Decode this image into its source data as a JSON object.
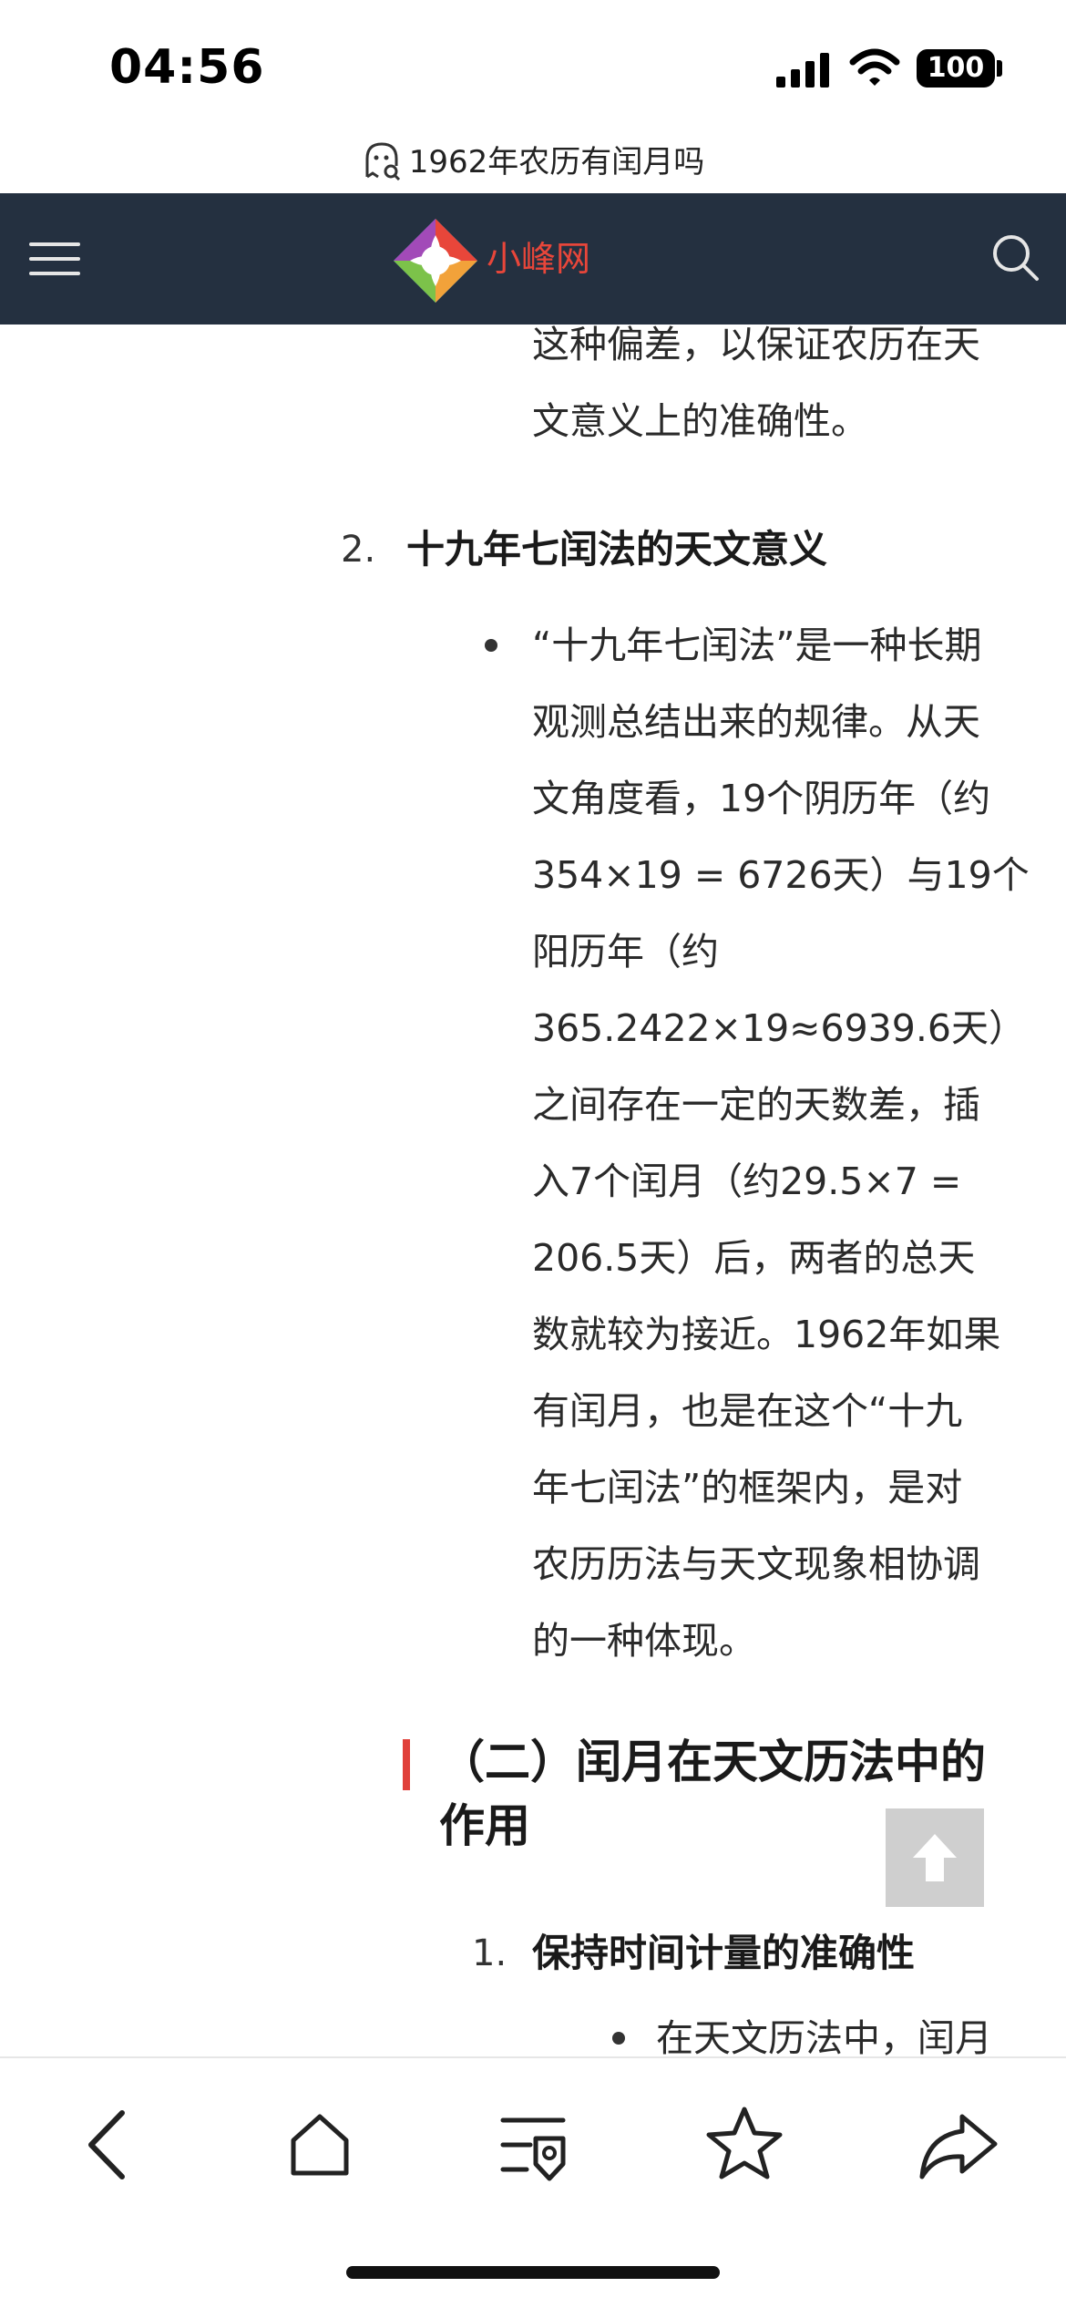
{
  "status_bar": {
    "time": "04:56",
    "battery": "100"
  },
  "page": {
    "url_title": "1962年农历有闰月吗"
  },
  "site": {
    "name": "小峰网"
  },
  "article": {
    "intro_lines": [
      "这种偏差，以保证农历在天",
      "文意义上的准确性。"
    ],
    "item2": {
      "number": "2.",
      "title": "十九年七闰法的天文意义",
      "lines": [
        "“十九年七闰法”是一种长期",
        "观测总结出来的规律。从天",
        "文角度看，19个阴历年（约",
        "354×19 = 6726天）与19个",
        "阳历年（约",
        "365.2422×19≈6939.6天）",
        "之间存在一定的天数差，插",
        "入7个闰月（约29.5×7 =",
        "206.5天）后，两者的总天",
        "数就较为接近。1962年如果",
        "有闰月，也是在这个“十九",
        "年七闰法”的框架内，是对",
        "农历历法与天文现象相协调",
        "的一种体现。"
      ]
    },
    "section2": {
      "title_line1": "（二）闰月在天文历法中的",
      "title_line2": "作用"
    },
    "item1": {
      "number": "1.",
      "title": "保持时间计量的准确性",
      "first_line": "在天文历法中，闰月"
    }
  },
  "icons": {
    "back": "chevron-left-icon",
    "home": "home-icon",
    "tabs": "tabs-search-icon",
    "favorite": "star-icon",
    "share": "share-icon",
    "back_to_top": "arrow-up-icon"
  }
}
